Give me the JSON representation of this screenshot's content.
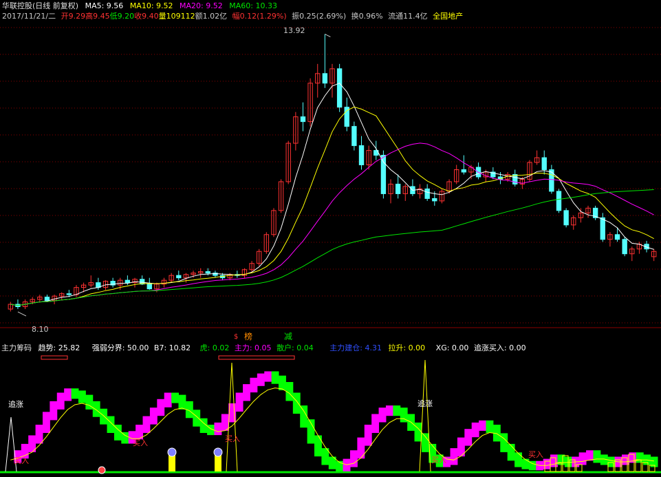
{
  "header": {
    "name": "华联控股(日线 前复权)",
    "ma5": "MA5: 9.56",
    "ma10": "MA10: 9.52",
    "ma20": "MA20: 9.52",
    "ma60": "MA60: 10.33",
    "date": "2017/11/21/二",
    "open": "开9.29",
    "high": "高9.45",
    "low": "低9.20",
    "close": "收9.40",
    "volume": "量109112",
    "amount": "额1.02亿",
    "change": "幅0.12(1.29%)",
    "amplitude": "振0.25(2.69%)",
    "turnover": "换0.96%",
    "float": "流通11.4亿",
    "sector": "全国地产"
  },
  "colors": {
    "up": "#ff3232",
    "down": "#54ffff",
    "ma5": "#ffffff",
    "ma10": "#ffff00",
    "ma20": "#ff00ff",
    "ma60": "#00e600",
    "grid": "#8b0000",
    "magenta": "#ff00ff",
    "green": "#00ff00",
    "yellow": "#ffff00"
  },
  "annotations": {
    "high_label": "13.92",
    "low_label": "8.10"
  },
  "indicator": {
    "name": "主力筹码",
    "trend": "趋势: 25.82",
    "threshold": "强弱分界: 50.00",
    "b7": "B7: 10.82",
    "tiger": "虎: 0.02",
    "main": "主力: 0.05",
    "retail": "散户: 0.04",
    "main_build": "主力建仓: 4.31",
    "pullup": "拉升: 0.00",
    "xg": "XG: 0.00",
    "chase_buy": "追涨买入: 0.00",
    "tag_list": "榜",
    "tag_reduce": "减",
    "tag_dollar": "$",
    "chase_label": "追涨",
    "buy_label": "买入"
  },
  "chart_data": [
    {
      "type": "candlestick",
      "title": "华联控股(日线 前复权)",
      "ylim": [
        7.9,
        14.2
      ],
      "ohlc": [
        [
          8.2,
          8.35,
          8.15,
          8.3
        ],
        [
          8.3,
          8.4,
          8.2,
          8.25
        ],
        [
          8.25,
          8.4,
          8.2,
          8.35
        ],
        [
          8.35,
          8.45,
          8.3,
          8.4
        ],
        [
          8.4,
          8.5,
          8.35,
          8.45
        ],
        [
          8.45,
          8.5,
          8.35,
          8.38
        ],
        [
          8.38,
          8.5,
          8.3,
          8.47
        ],
        [
          8.47,
          8.55,
          8.4,
          8.52
        ],
        [
          8.52,
          8.6,
          8.45,
          8.5
        ],
        [
          8.5,
          8.7,
          8.45,
          8.65
        ],
        [
          8.65,
          8.75,
          8.55,
          8.7
        ],
        [
          8.7,
          8.9,
          8.65,
          8.75
        ],
        [
          8.75,
          8.85,
          8.6,
          8.65
        ],
        [
          8.65,
          8.8,
          8.6,
          8.78
        ],
        [
          8.78,
          8.85,
          8.65,
          8.7
        ],
        [
          8.7,
          8.85,
          8.6,
          8.8
        ],
        [
          8.8,
          8.9,
          8.7,
          8.75
        ],
        [
          8.75,
          8.85,
          8.65,
          8.82
        ],
        [
          8.82,
          8.9,
          8.7,
          8.72
        ],
        [
          8.72,
          8.85,
          8.6,
          8.62
        ],
        [
          8.62,
          8.75,
          8.55,
          8.72
        ],
        [
          8.72,
          8.85,
          8.65,
          8.8
        ],
        [
          8.8,
          8.95,
          8.75,
          8.9
        ],
        [
          8.9,
          9.0,
          8.8,
          8.85
        ],
        [
          8.85,
          8.95,
          8.75,
          8.92
        ],
        [
          8.92,
          9.0,
          8.85,
          8.95
        ],
        [
          8.95,
          9.05,
          8.85,
          8.98
        ],
        [
          8.98,
          9.05,
          8.9,
          8.95
        ],
        [
          8.95,
          9.0,
          8.85,
          8.9
        ],
        [
          8.9,
          8.95,
          8.8,
          8.85
        ],
        [
          8.85,
          8.95,
          8.8,
          8.92
        ],
        [
          8.92,
          9.0,
          8.85,
          8.9
        ],
        [
          8.9,
          9.05,
          8.85,
          9.02
        ],
        [
          9.02,
          9.2,
          8.98,
          9.15
        ],
        [
          9.15,
          9.45,
          9.1,
          9.4
        ],
        [
          9.4,
          9.8,
          9.35,
          9.75
        ],
        [
          9.75,
          10.3,
          9.7,
          10.25
        ],
        [
          10.25,
          10.9,
          10.2,
          10.85
        ],
        [
          10.85,
          11.7,
          10.8,
          11.65
        ],
        [
          11.65,
          12.3,
          11.5,
          12.2
        ],
        [
          12.2,
          12.5,
          11.9,
          12.1
        ],
        [
          12.1,
          13.0,
          12.0,
          12.9
        ],
        [
          12.9,
          13.3,
          12.6,
          13.1
        ],
        [
          13.1,
          13.92,
          12.8,
          12.9
        ],
        [
          12.9,
          13.3,
          12.6,
          13.2
        ],
        [
          13.2,
          13.3,
          12.3,
          12.4
        ],
        [
          12.4,
          12.6,
          11.9,
          12.0
        ],
        [
          12.0,
          12.1,
          11.5,
          11.6
        ],
        [
          11.6,
          11.8,
          11.1,
          11.2
        ],
        [
          11.2,
          11.6,
          11.1,
          11.5
        ],
        [
          11.5,
          11.7,
          11.3,
          11.4
        ],
        [
          11.4,
          11.5,
          10.5,
          10.6
        ],
        [
          10.6,
          10.9,
          10.4,
          10.8
        ],
        [
          10.8,
          11.0,
          10.5,
          10.6
        ],
        [
          10.6,
          10.8,
          10.45,
          10.75
        ],
        [
          10.75,
          10.9,
          10.55,
          10.6
        ],
        [
          10.6,
          10.8,
          10.5,
          10.7
        ],
        [
          10.7,
          10.8,
          10.45,
          10.5
        ],
        [
          10.5,
          10.65,
          10.35,
          10.45
        ],
        [
          10.45,
          10.7,
          10.4,
          10.65
        ],
        [
          10.65,
          10.9,
          10.6,
          10.85
        ],
        [
          10.85,
          11.2,
          10.8,
          11.1
        ],
        [
          11.1,
          11.4,
          11.0,
          11.05
        ],
        [
          11.05,
          11.2,
          10.9,
          11.15
        ],
        [
          11.15,
          11.25,
          10.9,
          10.95
        ],
        [
          10.95,
          11.1,
          10.85,
          11.05
        ],
        [
          11.05,
          11.15,
          10.9,
          10.95
        ],
        [
          10.95,
          11.05,
          10.8,
          10.9
        ],
        [
          10.9,
          11.05,
          10.85,
          11.0
        ],
        [
          11.0,
          11.1,
          10.75,
          10.8
        ],
        [
          10.8,
          10.95,
          10.7,
          10.9
        ],
        [
          10.9,
          11.3,
          10.85,
          11.25
        ],
        [
          11.25,
          11.5,
          11.2,
          11.35
        ],
        [
          11.35,
          11.5,
          11.0,
          11.1
        ],
        [
          11.1,
          11.2,
          10.6,
          10.65
        ],
        [
          10.65,
          10.7,
          10.2,
          10.25
        ],
        [
          10.25,
          10.3,
          9.9,
          9.95
        ],
        [
          9.95,
          10.15,
          9.85,
          10.1
        ],
        [
          10.1,
          10.3,
          10.0,
          10.2
        ],
        [
          10.2,
          10.35,
          10.1,
          10.3
        ],
        [
          10.3,
          10.35,
          10.05,
          10.1
        ],
        [
          10.1,
          10.2,
          9.6,
          9.65
        ],
        [
          9.65,
          9.8,
          9.5,
          9.75
        ],
        [
          9.75,
          9.9,
          9.6,
          9.65
        ],
        [
          9.65,
          9.7,
          9.3,
          9.35
        ],
        [
          9.35,
          9.5,
          9.2,
          9.45
        ],
        [
          9.45,
          9.6,
          9.35,
          9.55
        ],
        [
          9.55,
          9.62,
          9.38,
          9.45
        ],
        [
          9.29,
          9.45,
          9.2,
          9.4
        ]
      ]
    },
    {
      "type": "line",
      "title": "主力筹码",
      "ylim": [
        0,
        100
      ],
      "series": [
        {
          "name": "趋势",
          "values": [
            12,
            16,
            22,
            30,
            40,
            52,
            62,
            70,
            74,
            72,
            68,
            62,
            55,
            48,
            40,
            33,
            30,
            34,
            40,
            48,
            56,
            64,
            70,
            68,
            62,
            54,
            46,
            40,
            38,
            42,
            50,
            60,
            70,
            78,
            84,
            88,
            90,
            86,
            80,
            70,
            58,
            45,
            30,
            18,
            10,
            6,
            4,
            8,
            16,
            28,
            40,
            50,
            56,
            58,
            56,
            50,
            42,
            32,
            22,
            12,
            8,
            10,
            18,
            28,
            36,
            42,
            44,
            40,
            32,
            22,
            14,
            8,
            6,
            5,
            6,
            8,
            12,
            10,
            8,
            10,
            14,
            16,
            12,
            10,
            8,
            10,
            12,
            14,
            12,
            10,
            8
          ]
        },
        {
          "name": "强弱分界",
          "values": [
            50,
            50,
            50,
            50,
            50,
            50,
            50,
            50,
            50,
            50,
            50,
            50,
            50,
            50,
            50,
            50,
            50,
            50,
            50,
            50,
            50,
            50,
            50,
            50,
            50,
            50,
            50,
            50,
            50,
            50,
            50,
            50,
            50,
            50,
            50,
            50,
            50,
            50,
            50,
            50,
            50,
            50,
            50,
            50,
            50,
            50,
            50,
            50,
            50,
            50,
            50,
            50,
            50,
            50,
            50,
            50,
            50,
            50,
            50,
            50,
            50,
            50,
            50,
            50,
            50,
            50,
            50,
            50,
            50,
            50,
            50,
            50,
            50,
            50,
            50,
            50,
            50,
            50,
            50,
            50,
            50,
            50,
            50,
            50,
            50,
            50,
            50,
            50,
            50,
            50,
            50
          ]
        }
      ]
    }
  ]
}
